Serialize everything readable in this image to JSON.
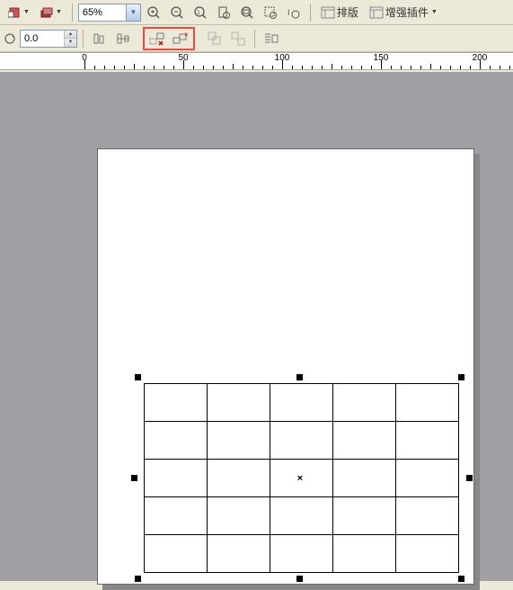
{
  "toolbar1": {
    "zoom_value": "65%",
    "buttons": {
      "typesetting_label": "排版",
      "enhance_plugin_label": "增强插件"
    }
  },
  "toolbar2": {
    "rotation_value": "0.0"
  },
  "ruler": {
    "marks": [
      {
        "value": "0",
        "pos": 94
      },
      {
        "value": "50",
        "pos": 204
      },
      {
        "value": "100",
        "pos": 314
      },
      {
        "value": "150",
        "pos": 424
      },
      {
        "value": "200",
        "pos": 534
      }
    ]
  },
  "canvas": {
    "table": {
      "rows": 5,
      "cols": 5
    },
    "center_mark": "×"
  }
}
